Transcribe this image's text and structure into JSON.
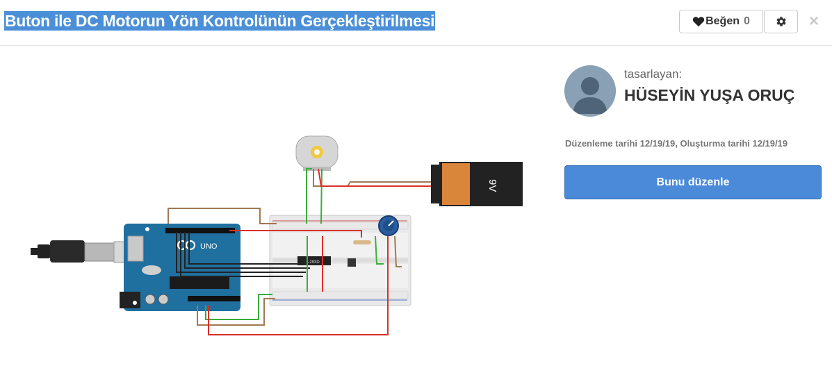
{
  "header": {
    "title": "Buton ile DC Motorun Yön Kontrolünün Gerçekleştirilmesi",
    "like_label": "Beğen",
    "like_count": "0",
    "close_symbol": "×"
  },
  "icons": {
    "like": "heart-icon",
    "settings": "gear-icon",
    "close": "close-icon",
    "avatar": "user-silhouette-icon"
  },
  "sidebar": {
    "designed_by_label": "tasarlayan:",
    "author_name": "HÜSEYİN YUŞA ORUÇ",
    "dates": "Düzenleme tarihi 12/19/19, Oluşturma tarihi 12/19/19",
    "edit_button_label": "Bunu düzenle"
  },
  "circuit": {
    "board_label": "UNO",
    "battery_label": "9V",
    "chip_label": "L293D"
  },
  "colors": {
    "accent": "#4a8ad8",
    "title_highlight": "#4a8fd8",
    "board": "#1f6f9f",
    "wire_red": "#d9302a",
    "wire_green": "#3aae3a",
    "wire_brown": "#a07850",
    "wire_black": "#222222"
  }
}
